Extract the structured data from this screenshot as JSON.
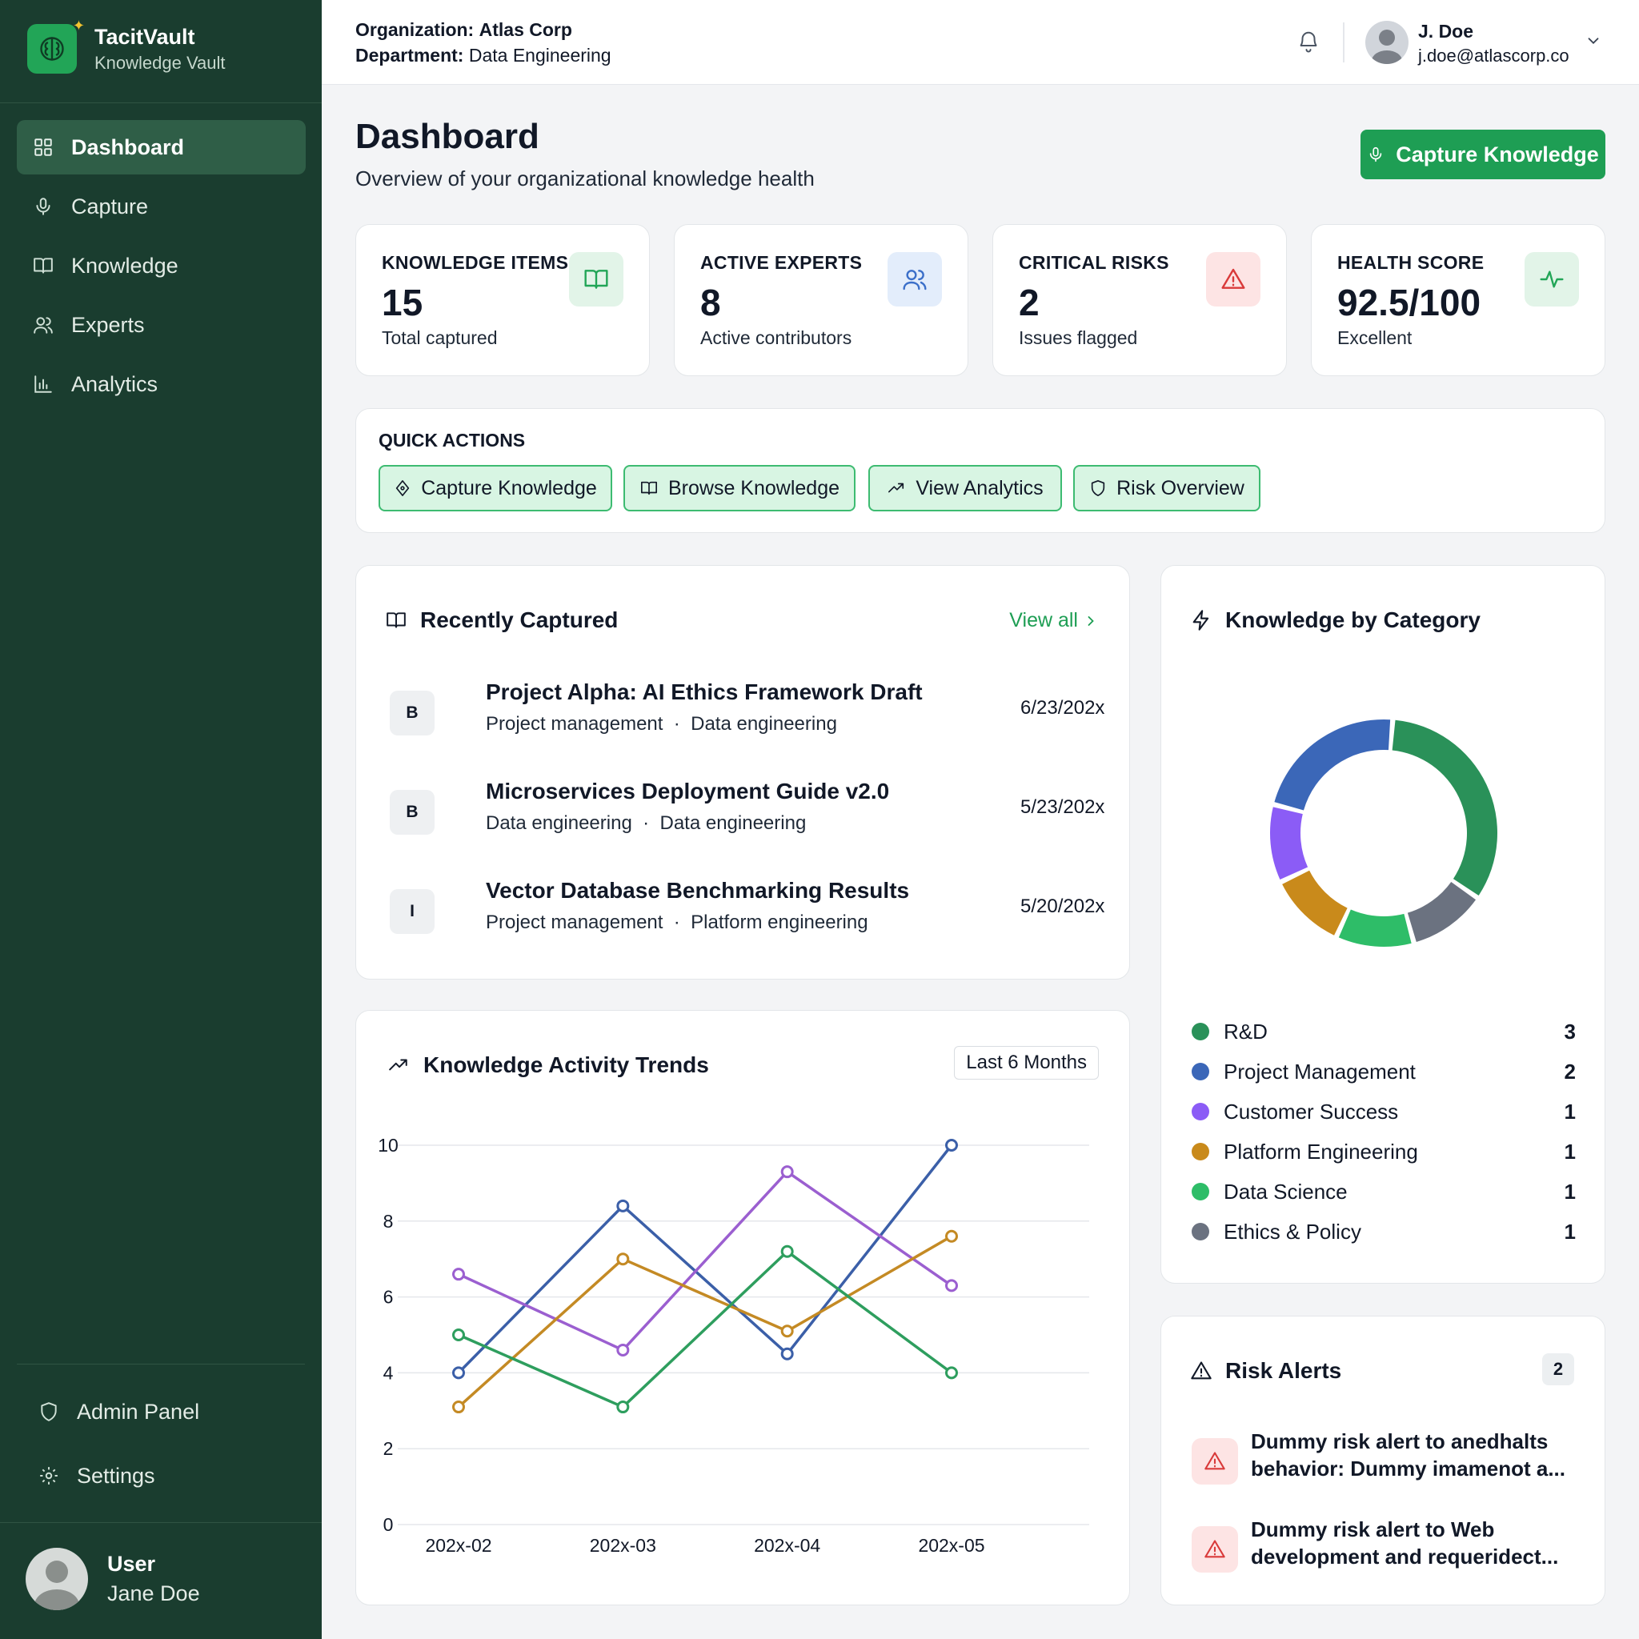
{
  "brand": {
    "name": "TacitVault",
    "subtitle": "Knowledge Vault"
  },
  "sidebar": {
    "items": [
      {
        "label": "Dashboard",
        "icon": "grid-icon",
        "active": true
      },
      {
        "label": "Capture",
        "icon": "mic-icon"
      },
      {
        "label": "Knowledge",
        "icon": "book-icon"
      },
      {
        "label": "Experts",
        "icon": "users-icon"
      },
      {
        "label": "Analytics",
        "icon": "bar-chart-icon"
      }
    ],
    "bottom_items": [
      {
        "label": "Admin Panel",
        "icon": "shield-icon"
      },
      {
        "label": "Settings",
        "icon": "gear-icon"
      }
    ],
    "user": {
      "role": "User",
      "name": "Jane Doe"
    }
  },
  "header": {
    "org_label": "Organization:",
    "org_value": "Atlas Corp",
    "dept_label": "Department:",
    "dept_value": "Data Engineering",
    "user_name": "J. Doe",
    "user_email": "j.doe@atlascorp.co"
  },
  "page": {
    "title": "Dashboard",
    "subtitle": "Overview of your organizational knowledge health",
    "primary_action": "Capture Knowledge"
  },
  "stats": [
    {
      "label": "KNOWLEDGE ITEMS",
      "value": "15",
      "note": "Total captured",
      "icon": "book-icon",
      "icon_bg": "#e2f4e8",
      "icon_color": "#22a557"
    },
    {
      "label": "ACTIVE EXPERTS",
      "value": "8",
      "note": "Active contributors",
      "icon": "users-icon",
      "icon_bg": "#e3edfb",
      "icon_color": "#3b6fc9"
    },
    {
      "label": "CRITICAL RISKS",
      "value": "2",
      "note": "Issues flagged",
      "icon": "alert-triangle-icon",
      "icon_bg": "#fde4e4",
      "icon_color": "#d93a3a"
    },
    {
      "label": "HEALTH SCORE",
      "value": "92.5/100",
      "note": "Excellent",
      "icon": "activity-icon",
      "icon_bg": "#e2f4e8",
      "icon_color": "#22a557"
    }
  ],
  "quick_actions": {
    "title": "QUICK ACTIONS",
    "buttons": [
      {
        "label": "Capture Knowledge",
        "icon": "diamond-pen-icon"
      },
      {
        "label": "Browse Knowledge",
        "icon": "book-icon"
      },
      {
        "label": "View Analytics",
        "icon": "trending-up-icon"
      },
      {
        "label": "Risk Overview",
        "icon": "shield-icon"
      }
    ]
  },
  "recent": {
    "title": "Recently Captured",
    "view_all": "View all",
    "items": [
      {
        "badge": "B",
        "title": "Project Alpha: AI Ethics Framework Draft",
        "tag1": "Project management",
        "tag2": "Data engineering",
        "date": "6/23/202x"
      },
      {
        "badge": "B",
        "title": "Microservices Deployment Guide v2.0",
        "tag1": "Data engineering",
        "tag2": "Data engineering",
        "date": "5/23/202x"
      },
      {
        "badge": "I",
        "title": "Vector Database Benchmarking Results",
        "tag1": "Project management",
        "tag2": "Platform engineering",
        "date": "5/20/202x"
      }
    ]
  },
  "category": {
    "title": "Knowledge by Category",
    "items": [
      {
        "label": "R&D",
        "count": 3,
        "color": "#2a9159"
      },
      {
        "label": "Project Management",
        "count": 2,
        "color": "#3b67b8"
      },
      {
        "label": "Customer Success",
        "count": 1,
        "color": "#8b5cf6"
      },
      {
        "label": "Platform Engineering",
        "count": 1,
        "color": "#c98a1b"
      },
      {
        "label": "Data Science",
        "count": 1,
        "color": "#2ebd68"
      },
      {
        "label": "Ethics & Policy",
        "count": 1,
        "color": "#6b7280"
      }
    ]
  },
  "trends": {
    "title": "Knowledge Activity Trends",
    "range": "Last 6 Months"
  },
  "chart_data": {
    "type": "line",
    "x": [
      "202x-02",
      "202x-03",
      "202x-04",
      "202x-05"
    ],
    "ylim": [
      0,
      10
    ],
    "yticks": [
      "0",
      "2",
      "4",
      "6",
      "8",
      "10"
    ],
    "series": [
      {
        "values": [
          4,
          8.4,
          4.5,
          10
        ],
        "color": "#3b5fa8"
      },
      {
        "values": [
          6.6,
          4.6,
          9.3,
          6.3
        ],
        "color": "#9b5fd0"
      },
      {
        "values": [
          3.1,
          7,
          5.1,
          7.6
        ],
        "color": "#c48a24"
      },
      {
        "values": [
          5,
          3.1,
          7.2,
          4
        ],
        "color": "#2e9e5e"
      }
    ]
  },
  "risks": {
    "title": "Risk Alerts",
    "count": "2",
    "items": [
      {
        "line1": "Dummy risk alert to anedhalts",
        "line2": "behavior: Dummy imamenot a..."
      },
      {
        "line1": "Dummy risk alert to Web",
        "line2": "development and requeridect..."
      }
    ]
  }
}
